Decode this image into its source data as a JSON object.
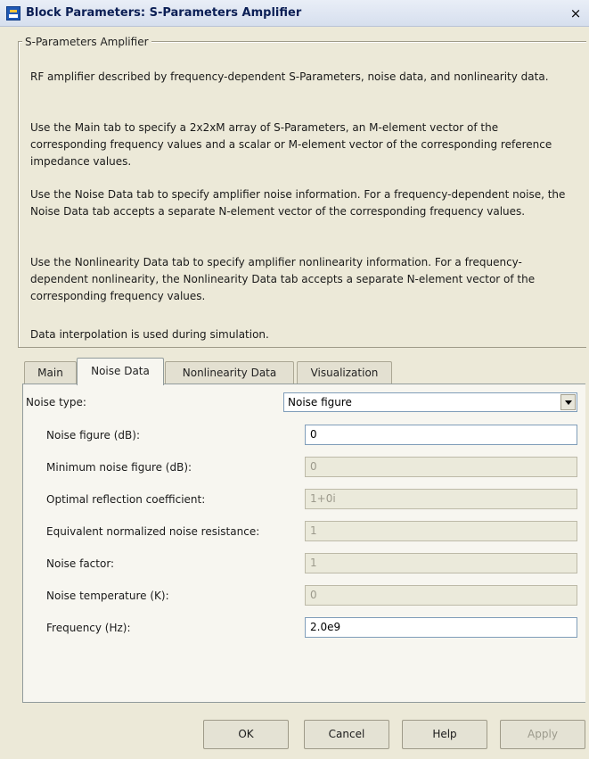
{
  "window": {
    "title": "Block Parameters: S-Parameters Amplifier",
    "close_label": "×"
  },
  "description": {
    "group_title": "S-Parameters Amplifier",
    "paragraphs": [
      "RF amplifier described by frequency-dependent S-Parameters, noise data, and nonlinearity data.",
      "Use the Main tab to specify a 2x2xM array of S-Parameters, an M-element vector of the corresponding frequency values and a scalar or M-element vector of the corresponding reference impedance values.",
      "Use the Noise Data tab to specify amplifier noise information. For a frequency-dependent noise, the Noise Data tab accepts a separate N-element vector of the corresponding frequency values.",
      "Use the Nonlinearity Data tab to specify amplifier nonlinearity information. For a frequency-dependent nonlinearity, the Nonlinearity Data tab accepts a separate N-element vector of the corresponding frequency values.",
      "Data interpolation is used during simulation."
    ]
  },
  "tabs": [
    {
      "label": "Main",
      "active": false
    },
    {
      "label": "Noise Data",
      "active": true
    },
    {
      "label": "Nonlinearity Data",
      "active": false
    },
    {
      "label": "Visualization",
      "active": false
    }
  ],
  "noise": {
    "type_label": "Noise type:",
    "type_value": "Noise figure",
    "fields": [
      {
        "label": "Noise figure (dB):",
        "value": "0",
        "enabled": true
      },
      {
        "label": "Minimum noise figure (dB):",
        "value": "0",
        "enabled": false
      },
      {
        "label": "Optimal reflection coefficient:",
        "value": "1+0i",
        "enabled": false
      },
      {
        "label": "Equivalent normalized noise resistance:",
        "value": "1",
        "enabled": false
      },
      {
        "label": "Noise factor:",
        "value": "1",
        "enabled": false
      },
      {
        "label": "Noise temperature (K):",
        "value": "0",
        "enabled": false
      },
      {
        "label": "Frequency (Hz):",
        "value": "2.0e9",
        "enabled": true
      }
    ]
  },
  "buttons": {
    "ok": "OK",
    "cancel": "Cancel",
    "help": "Help",
    "apply": "Apply"
  }
}
